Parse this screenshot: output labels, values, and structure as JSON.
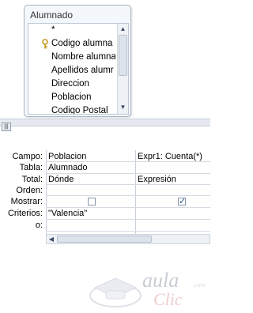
{
  "table": {
    "title": "Alumnado",
    "fields": [
      "*",
      "Codigo alumna",
      "Nombre alumna",
      "Apellidos alumr",
      "Direccion",
      "Poblacion",
      "Codigo Postal"
    ],
    "key_field_index": 1
  },
  "watermark": {
    "line1": "aula",
    "line2": "Clic",
    "suffix": ".com"
  },
  "grid": {
    "row_labels": [
      "Campo:",
      "Tabla:",
      "Total:",
      "Orden:",
      "Mostrar:",
      "Criterios:",
      "o:"
    ],
    "columns": [
      {
        "campo": "Poblacion",
        "tabla": "Alumnado",
        "total": "Dónde",
        "orden": "",
        "mostrar": false,
        "criterios": "\"Valencia\"",
        "o": ""
      },
      {
        "campo": "Expr1: Cuenta(*)",
        "tabla": "",
        "total": "Expresión",
        "orden": "",
        "mostrar": true,
        "criterios": "",
        "o": ""
      }
    ]
  },
  "scroll": {
    "up": "▲",
    "down": "▼",
    "left": "◀",
    "right": "▶"
  },
  "splitter_glyph": "|||"
}
